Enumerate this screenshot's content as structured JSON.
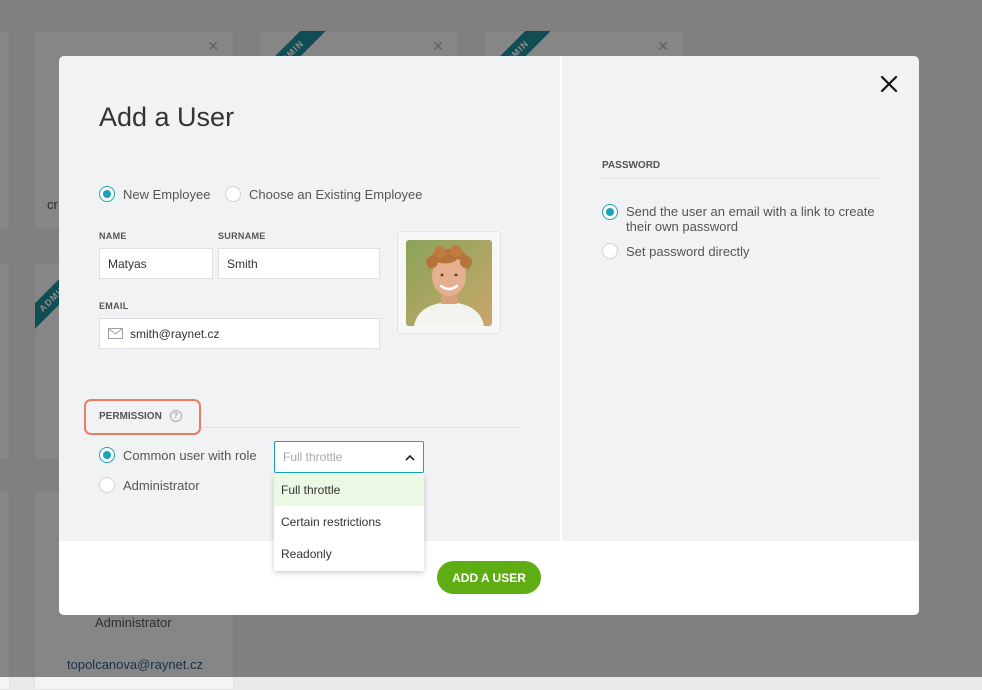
{
  "background": {
    "cards": [
      {
        "ribbon": "ADMIN"
      },
      {
        "ribbon": "ADMIN"
      },
      {
        "ribbon": "ADMIN"
      }
    ],
    "snippet_left": "cr",
    "role_text": "Administrator",
    "email_text": "topolcanova@raynet.cz"
  },
  "modal": {
    "title": "Add a User",
    "employee_options": {
      "new": "New Employee",
      "existing": "Choose an Existing Employee"
    },
    "form": {
      "name_label": "NAME",
      "name_value": "Matyas",
      "surname_label": "SURNAME",
      "surname_value": "Smith",
      "email_label": "EMAIL",
      "email_value": "smith@raynet.cz"
    },
    "permission": {
      "label": "PERMISSION",
      "help": "?",
      "common_user": "Common user with role",
      "administrator": "Administrator",
      "select": {
        "placeholder": "Full throttle",
        "options": [
          "Full throttle",
          "Certain restrictions",
          "Readonly"
        ]
      }
    },
    "password": {
      "label": "PASSWORD",
      "send_email": "Send the user an email with a link to create their own password",
      "set_directly": "Set password directly"
    },
    "submit": "ADD A USER"
  },
  "colors": {
    "accent": "#1aa3b5",
    "primary_button": "#5fad14",
    "highlight": "#ec7b62",
    "ribbon": "#1e8c9a"
  }
}
